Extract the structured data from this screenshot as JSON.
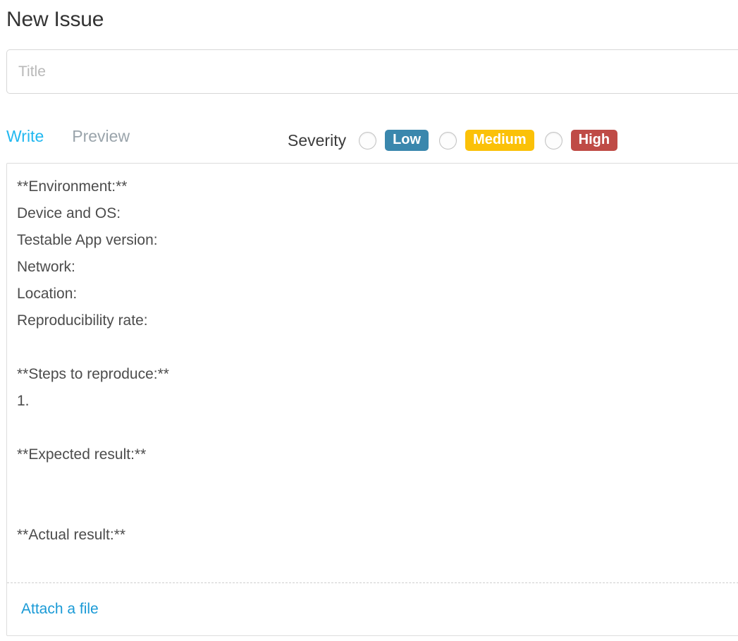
{
  "page": {
    "title": "New Issue"
  },
  "title_field": {
    "placeholder": "Title",
    "value": ""
  },
  "editor_tabs": [
    {
      "label": "Write",
      "active": true
    },
    {
      "label": "Preview",
      "active": false
    }
  ],
  "severity": {
    "label": "Severity",
    "selected": null,
    "options": [
      {
        "label": "Low",
        "color": "#3a87ad",
        "selected": false
      },
      {
        "label": "Medium",
        "color": "#fbc108",
        "selected": false
      },
      {
        "label": "High",
        "color": "#bf4b46",
        "selected": false
      }
    ]
  },
  "editor": {
    "body": "**Environment:**\nDevice and OS:\nTestable App version:\nNetwork:\nLocation:\nReproducibility rate:\n\n**Steps to reproduce:**\n1.\n\n**Expected result:**\n\n\n**Actual result:**",
    "placeholder": ""
  },
  "attachment": {
    "link_label": "Attach a file"
  },
  "colors": {
    "accent_link": "#1a9ad6",
    "tab_active": "#22b8f0",
    "tab_inactive": "#9aa4ab",
    "severity_low": "#3a87ad",
    "severity_medium": "#fbc108",
    "severity_high": "#bf4b46",
    "border": "#dddddd",
    "text": "#3c3c3c"
  }
}
